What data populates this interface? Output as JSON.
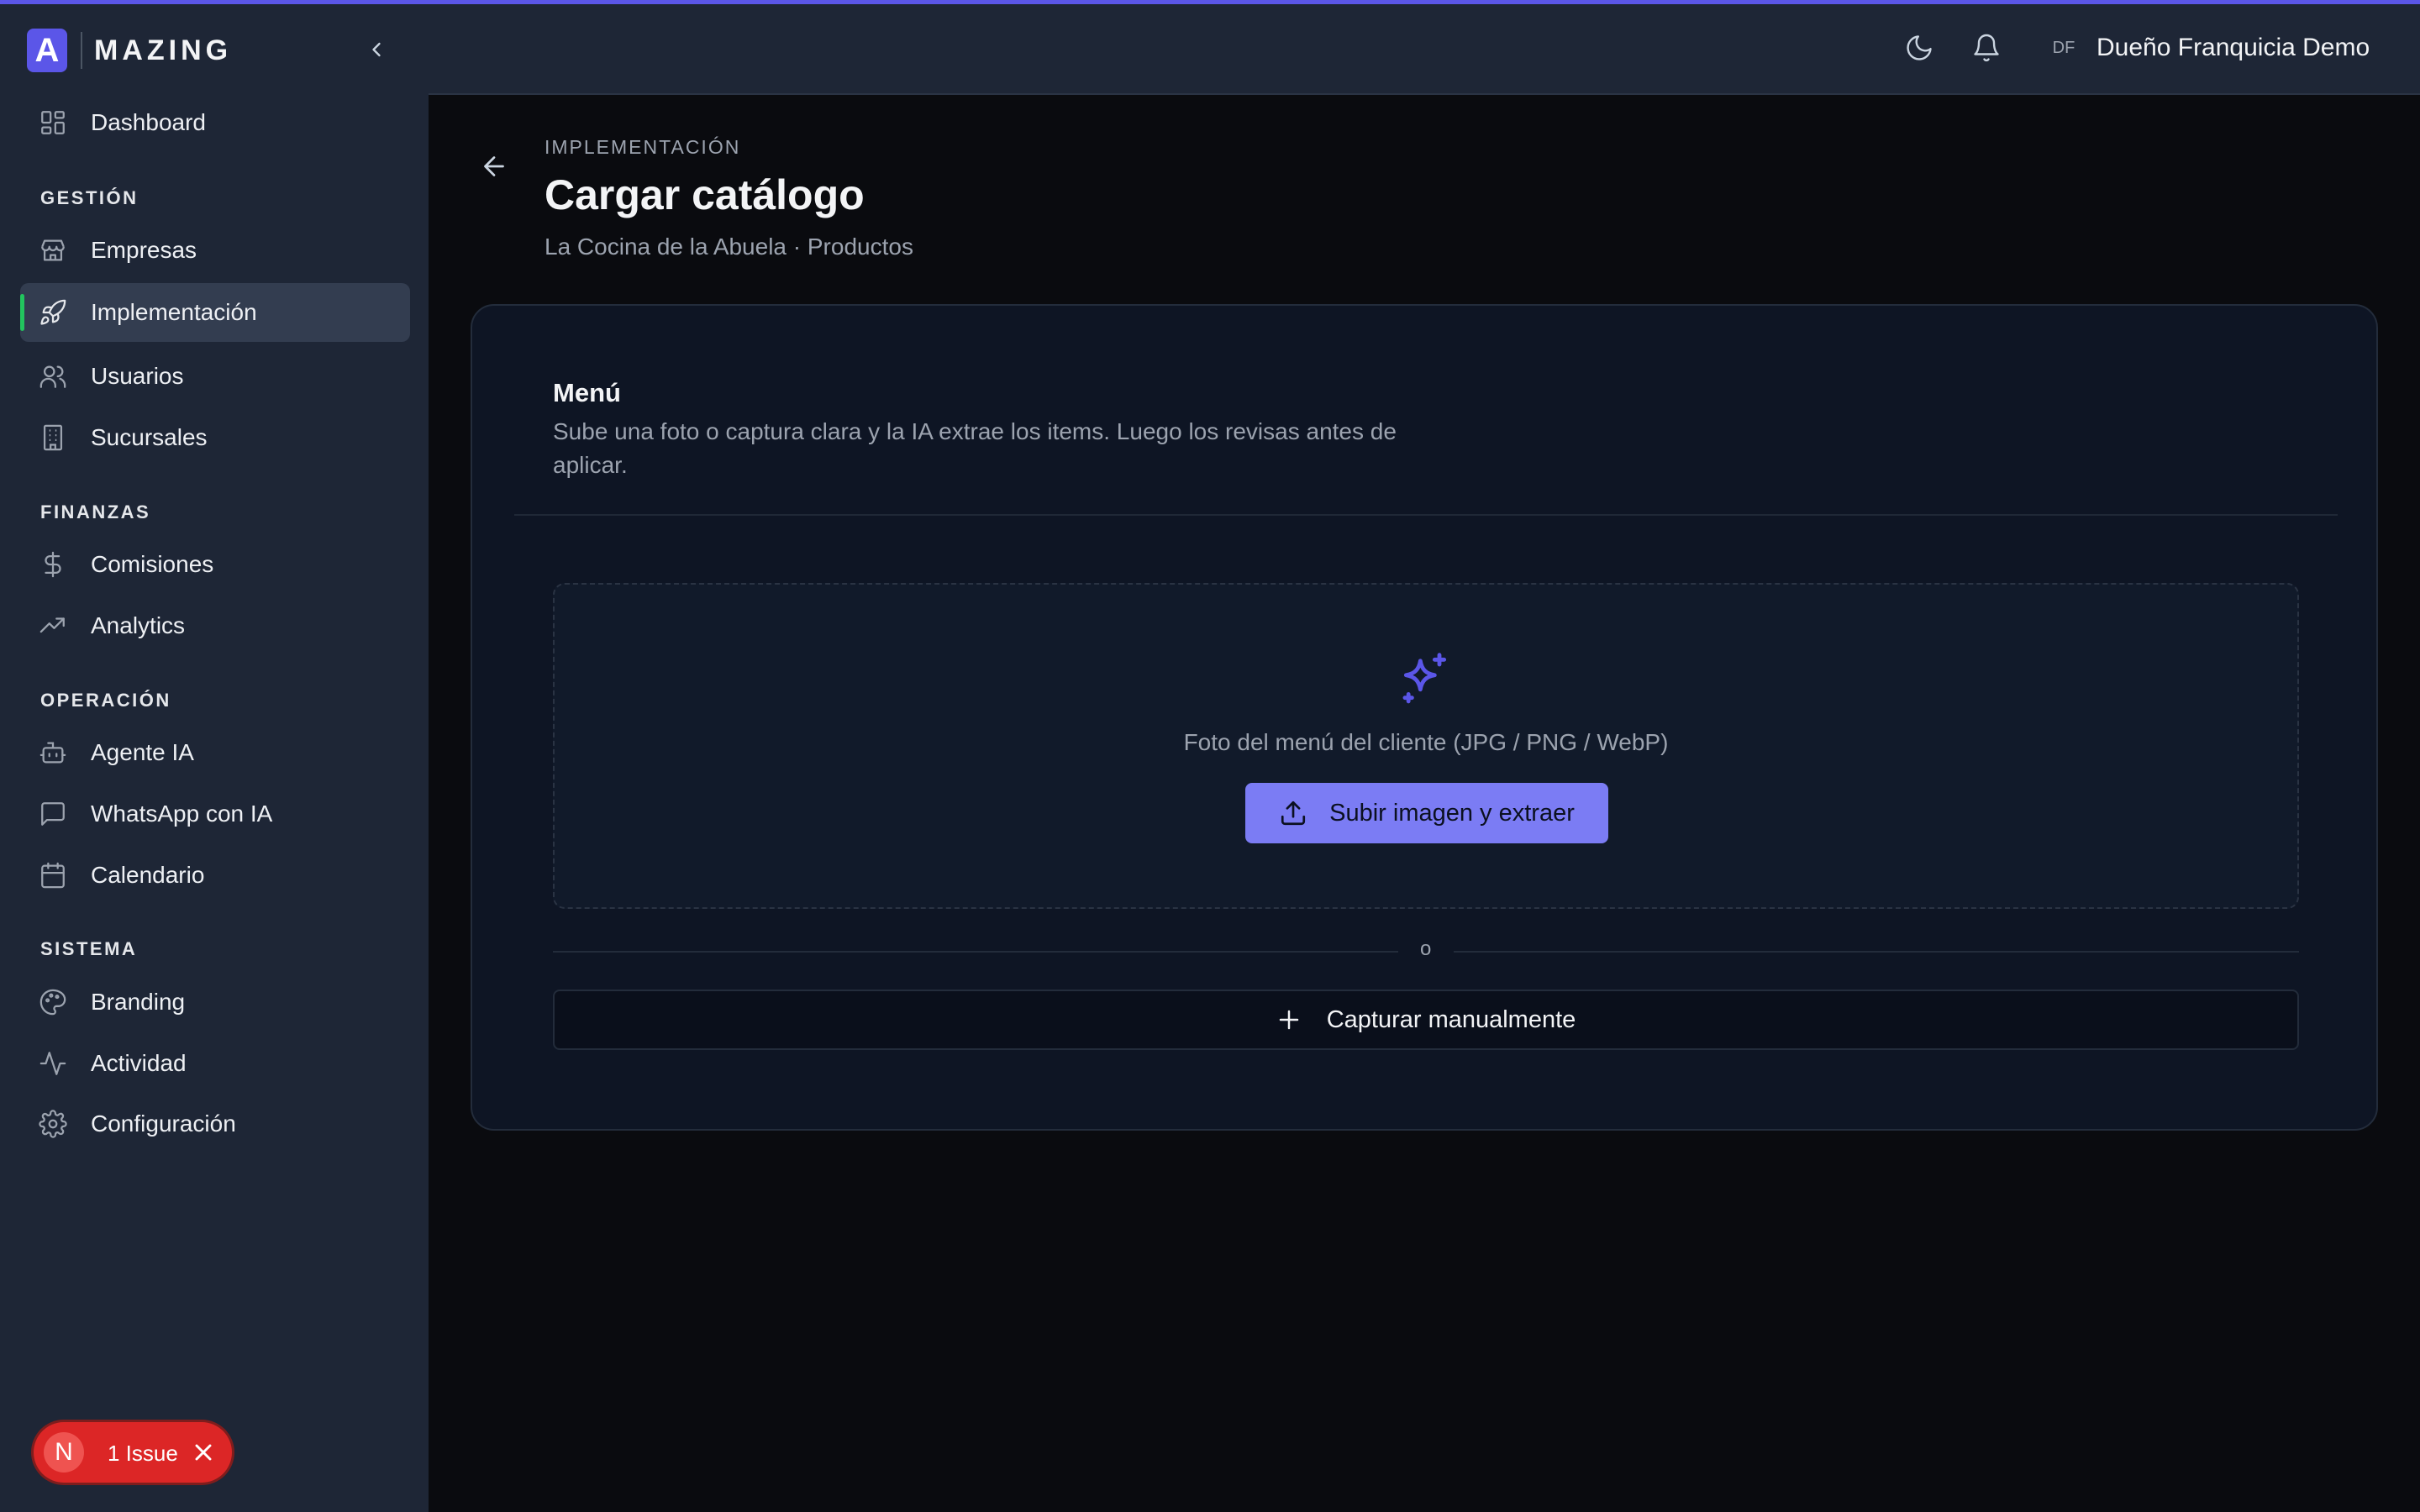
{
  "brand": {
    "logo_letter": "A",
    "name": "MAZING",
    "accent": "#5b56e8"
  },
  "sidebar": {
    "top_item": {
      "label": "Dashboard",
      "icon": "dashboard-grid-icon"
    },
    "sections": [
      {
        "title": "GESTIÓN",
        "items": [
          {
            "label": "Empresas",
            "icon": "store-icon"
          },
          {
            "label": "Implementación",
            "icon": "rocket-icon",
            "active": true
          },
          {
            "label": "Usuarios",
            "icon": "users-icon"
          },
          {
            "label": "Sucursales",
            "icon": "building-icon"
          }
        ]
      },
      {
        "title": "FINANZAS",
        "items": [
          {
            "label": "Comisiones",
            "icon": "dollar-icon"
          },
          {
            "label": "Analytics",
            "icon": "trending-up-icon"
          }
        ]
      },
      {
        "title": "OPERACIÓN",
        "items": [
          {
            "label": "Agente IA",
            "icon": "bot-icon"
          },
          {
            "label": "WhatsApp con IA",
            "icon": "message-square-icon"
          },
          {
            "label": "Calendario",
            "icon": "calendar-icon"
          }
        ]
      },
      {
        "title": "SISTEMA",
        "items": [
          {
            "label": "Branding",
            "icon": "palette-icon"
          },
          {
            "label": "Actividad",
            "icon": "activity-icon"
          },
          {
            "label": "Configuración",
            "icon": "gear-icon"
          }
        ]
      }
    ],
    "active_indicator_color": "#22c55e"
  },
  "header": {
    "user_initials": "DF",
    "user_name": "Dueño Franquicia Demo",
    "icons": [
      "moon-icon",
      "bell-icon"
    ]
  },
  "page": {
    "eyebrow": "IMPLEMENTACIÓN",
    "title": "Cargar catálogo",
    "subtitle": "La Cocina de la Abuela · Productos"
  },
  "card": {
    "title": "Menú",
    "description": "Sube una foto o captura clara y la IA extrae los items. Luego los revisas antes de aplicar.",
    "dropzone_text": "Foto del menú del cliente (JPG / PNG / WebP)",
    "upload_label": "Subir imagen y extraer",
    "or_label": "o",
    "manual_label": "Capturar manualmente",
    "primary_color": "#7b7cf4"
  },
  "issues": {
    "letter": "N",
    "label": "1 Issue",
    "color": "#dc2626"
  }
}
